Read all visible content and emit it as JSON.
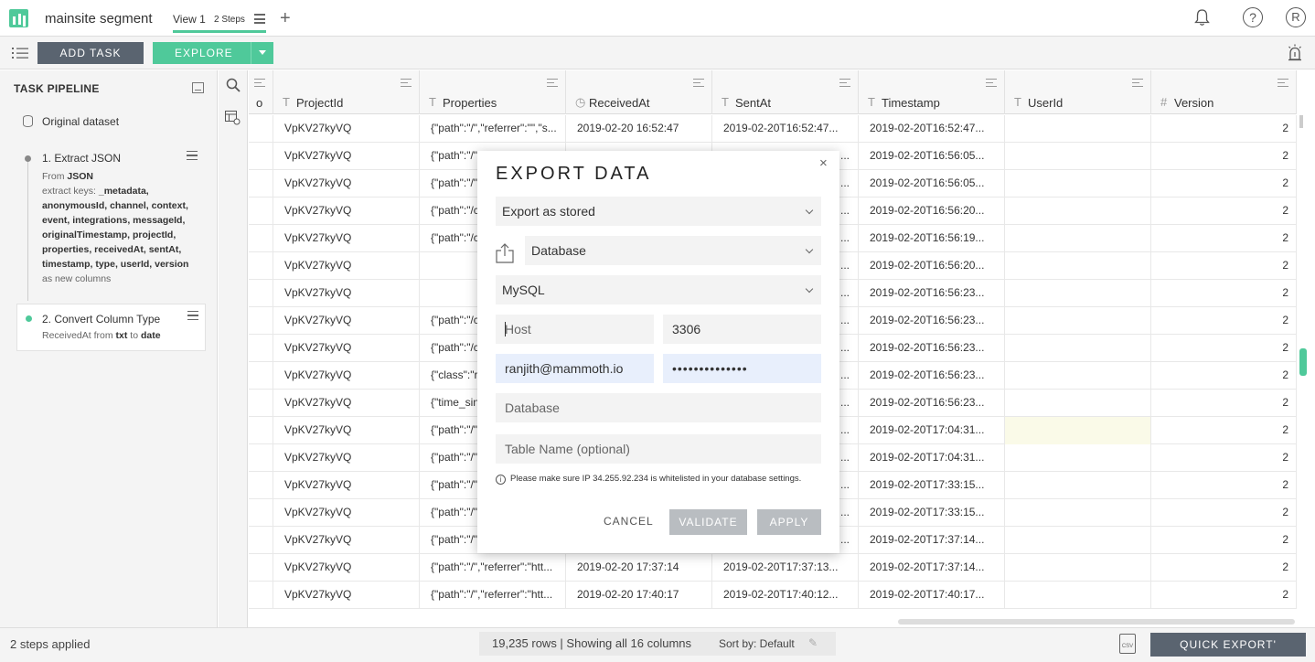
{
  "header": {
    "app_title": "mainsite segment",
    "view_tab": "View 1",
    "view_steps": "2 Steps",
    "user_initial": "R",
    "help_glyph": "?"
  },
  "toolbar": {
    "add_task_label": "ADD TASK",
    "explore_label": "EXPLORE"
  },
  "sidebar": {
    "title": "TASK PIPELINE",
    "original_dataset": "Original dataset",
    "steps": [
      {
        "title": "1. Extract JSON",
        "from_prefix": "From ",
        "from_value": "JSON",
        "keys_prefix": "extract keys: ",
        "keys": "_metadata, anonymousId, channel, context, event, integrations, messageId, originalTimestamp, projectId, properties, receivedAt, sentAt, timestamp, type, userId, version",
        "suffix": "as new columns"
      },
      {
        "title": "2. Convert Column Type",
        "col": "ReceivedAt",
        "from_word": " from ",
        "from_type": "txt",
        "to_word": " to ",
        "to_type": "date"
      }
    ]
  },
  "grid": {
    "columns": [
      {
        "type_icon": "",
        "name": "o"
      },
      {
        "type_icon": "T",
        "name": "ProjectId"
      },
      {
        "type_icon": "T",
        "name": "Properties"
      },
      {
        "type_icon": "◷",
        "name": "ReceivedAt"
      },
      {
        "type_icon": "T",
        "name": "SentAt"
      },
      {
        "type_icon": "T",
        "name": "Timestamp"
      },
      {
        "type_icon": "T",
        "name": "UserId"
      },
      {
        "type_icon": "#",
        "name": "Version"
      }
    ],
    "rows": [
      [
        "",
        "VpKV27kyVQ",
        "{\"path\":\"/\",\"referrer\":\"\",\"s...",
        "2019-02-20 16:52:47",
        "2019-02-20T16:52:47...",
        "2019-02-20T16:52:47...",
        "",
        "2"
      ],
      [
        "",
        "VpKV27kyVQ",
        "{\"path\":\"/\"",
        "",
        "...",
        "2019-02-20T16:56:05...",
        "",
        "2"
      ],
      [
        "",
        "VpKV27kyVQ",
        "{\"path\":\"/\"",
        "",
        "...",
        "2019-02-20T16:56:05...",
        "",
        "2"
      ],
      [
        "",
        "VpKV27kyVQ",
        "{\"path\":\"/c",
        "",
        "...",
        "2019-02-20T16:56:20...",
        "",
        "2"
      ],
      [
        "",
        "VpKV27kyVQ",
        "{\"path\":\"/c",
        "",
        "...",
        "2019-02-20T16:56:19...",
        "",
        "2"
      ],
      [
        "",
        "VpKV27kyVQ",
        "",
        "",
        "...",
        "2019-02-20T16:56:20...",
        "",
        "2"
      ],
      [
        "",
        "VpKV27kyVQ",
        "",
        "",
        "...",
        "2019-02-20T16:56:23...",
        "",
        "2"
      ],
      [
        "",
        "VpKV27kyVQ",
        "{\"path\":\"/c",
        "",
        "...",
        "2019-02-20T16:56:23...",
        "",
        "2"
      ],
      [
        "",
        "VpKV27kyVQ",
        "{\"path\":\"/c",
        "",
        "...",
        "2019-02-20T16:56:23...",
        "",
        "2"
      ],
      [
        "",
        "VpKV27kyVQ",
        "{\"class\":\"r",
        "",
        "...",
        "2019-02-20T16:56:23...",
        "",
        "2"
      ],
      [
        "",
        "VpKV27kyVQ",
        "{\"time_sin",
        "",
        "...",
        "2019-02-20T16:56:23...",
        "",
        "2"
      ],
      [
        "",
        "VpKV27kyVQ",
        "{\"path\":\"/\"",
        "",
        "...",
        "2019-02-20T17:04:31...",
        "",
        "2"
      ],
      [
        "",
        "VpKV27kyVQ",
        "{\"path\":\"/\"",
        "",
        "...",
        "2019-02-20T17:04:31...",
        "",
        "2"
      ],
      [
        "",
        "VpKV27kyVQ",
        "{\"path\":\"/\"",
        "",
        "...",
        "2019-02-20T17:33:15...",
        "",
        "2"
      ],
      [
        "",
        "VpKV27kyVQ",
        "{\"path\":\"/\"",
        "",
        "...",
        "2019-02-20T17:33:15...",
        "",
        "2"
      ],
      [
        "",
        "VpKV27kyVQ",
        "{\"path\":\"/\"",
        "",
        "...",
        "2019-02-20T17:37:14...",
        "",
        "2"
      ],
      [
        "",
        "VpKV27kyVQ",
        "{\"path\":\"/\",\"referrer\":\"htt...",
        "2019-02-20 17:37:14",
        "2019-02-20T17:37:13...",
        "2019-02-20T17:37:14...",
        "",
        "2"
      ],
      [
        "",
        "VpKV27kyVQ",
        "{\"path\":\"/\",\"referrer\":\"htt...",
        "2019-02-20 17:40:17",
        "2019-02-20T17:40:12...",
        "2019-02-20T17:40:17...",
        "",
        "2"
      ]
    ]
  },
  "statusbar": {
    "steps_applied": "2 steps applied",
    "rows_info": "19,235 rows | Showing all 16 columns",
    "sort_info": "Sort by: Default",
    "csv_label": "CSV",
    "quick_export_label": "QUICK EXPORT'"
  },
  "modal": {
    "title": "EXPORT DATA",
    "close_glyph": "×",
    "export_mode": "Export as stored",
    "destination": "Database",
    "db_engine": "MySQL",
    "host_placeholder": "Host",
    "port_value": "3306",
    "username_value": "ranjith@mammoth.io",
    "password_value": "••••••••••••••",
    "database_placeholder": "Database",
    "table_placeholder": "Table Name (optional)",
    "whitelist_note": "Please make sure IP 34.255.92.234 is whitelisted in your database settings.",
    "cancel_label": "CANCEL",
    "validate_label": "VALIDATE",
    "apply_label": "APPLY"
  },
  "colors": {
    "accent": "#4fc99a",
    "dark_button": "#5a6470",
    "disabled_button": "#b9bdc1"
  }
}
